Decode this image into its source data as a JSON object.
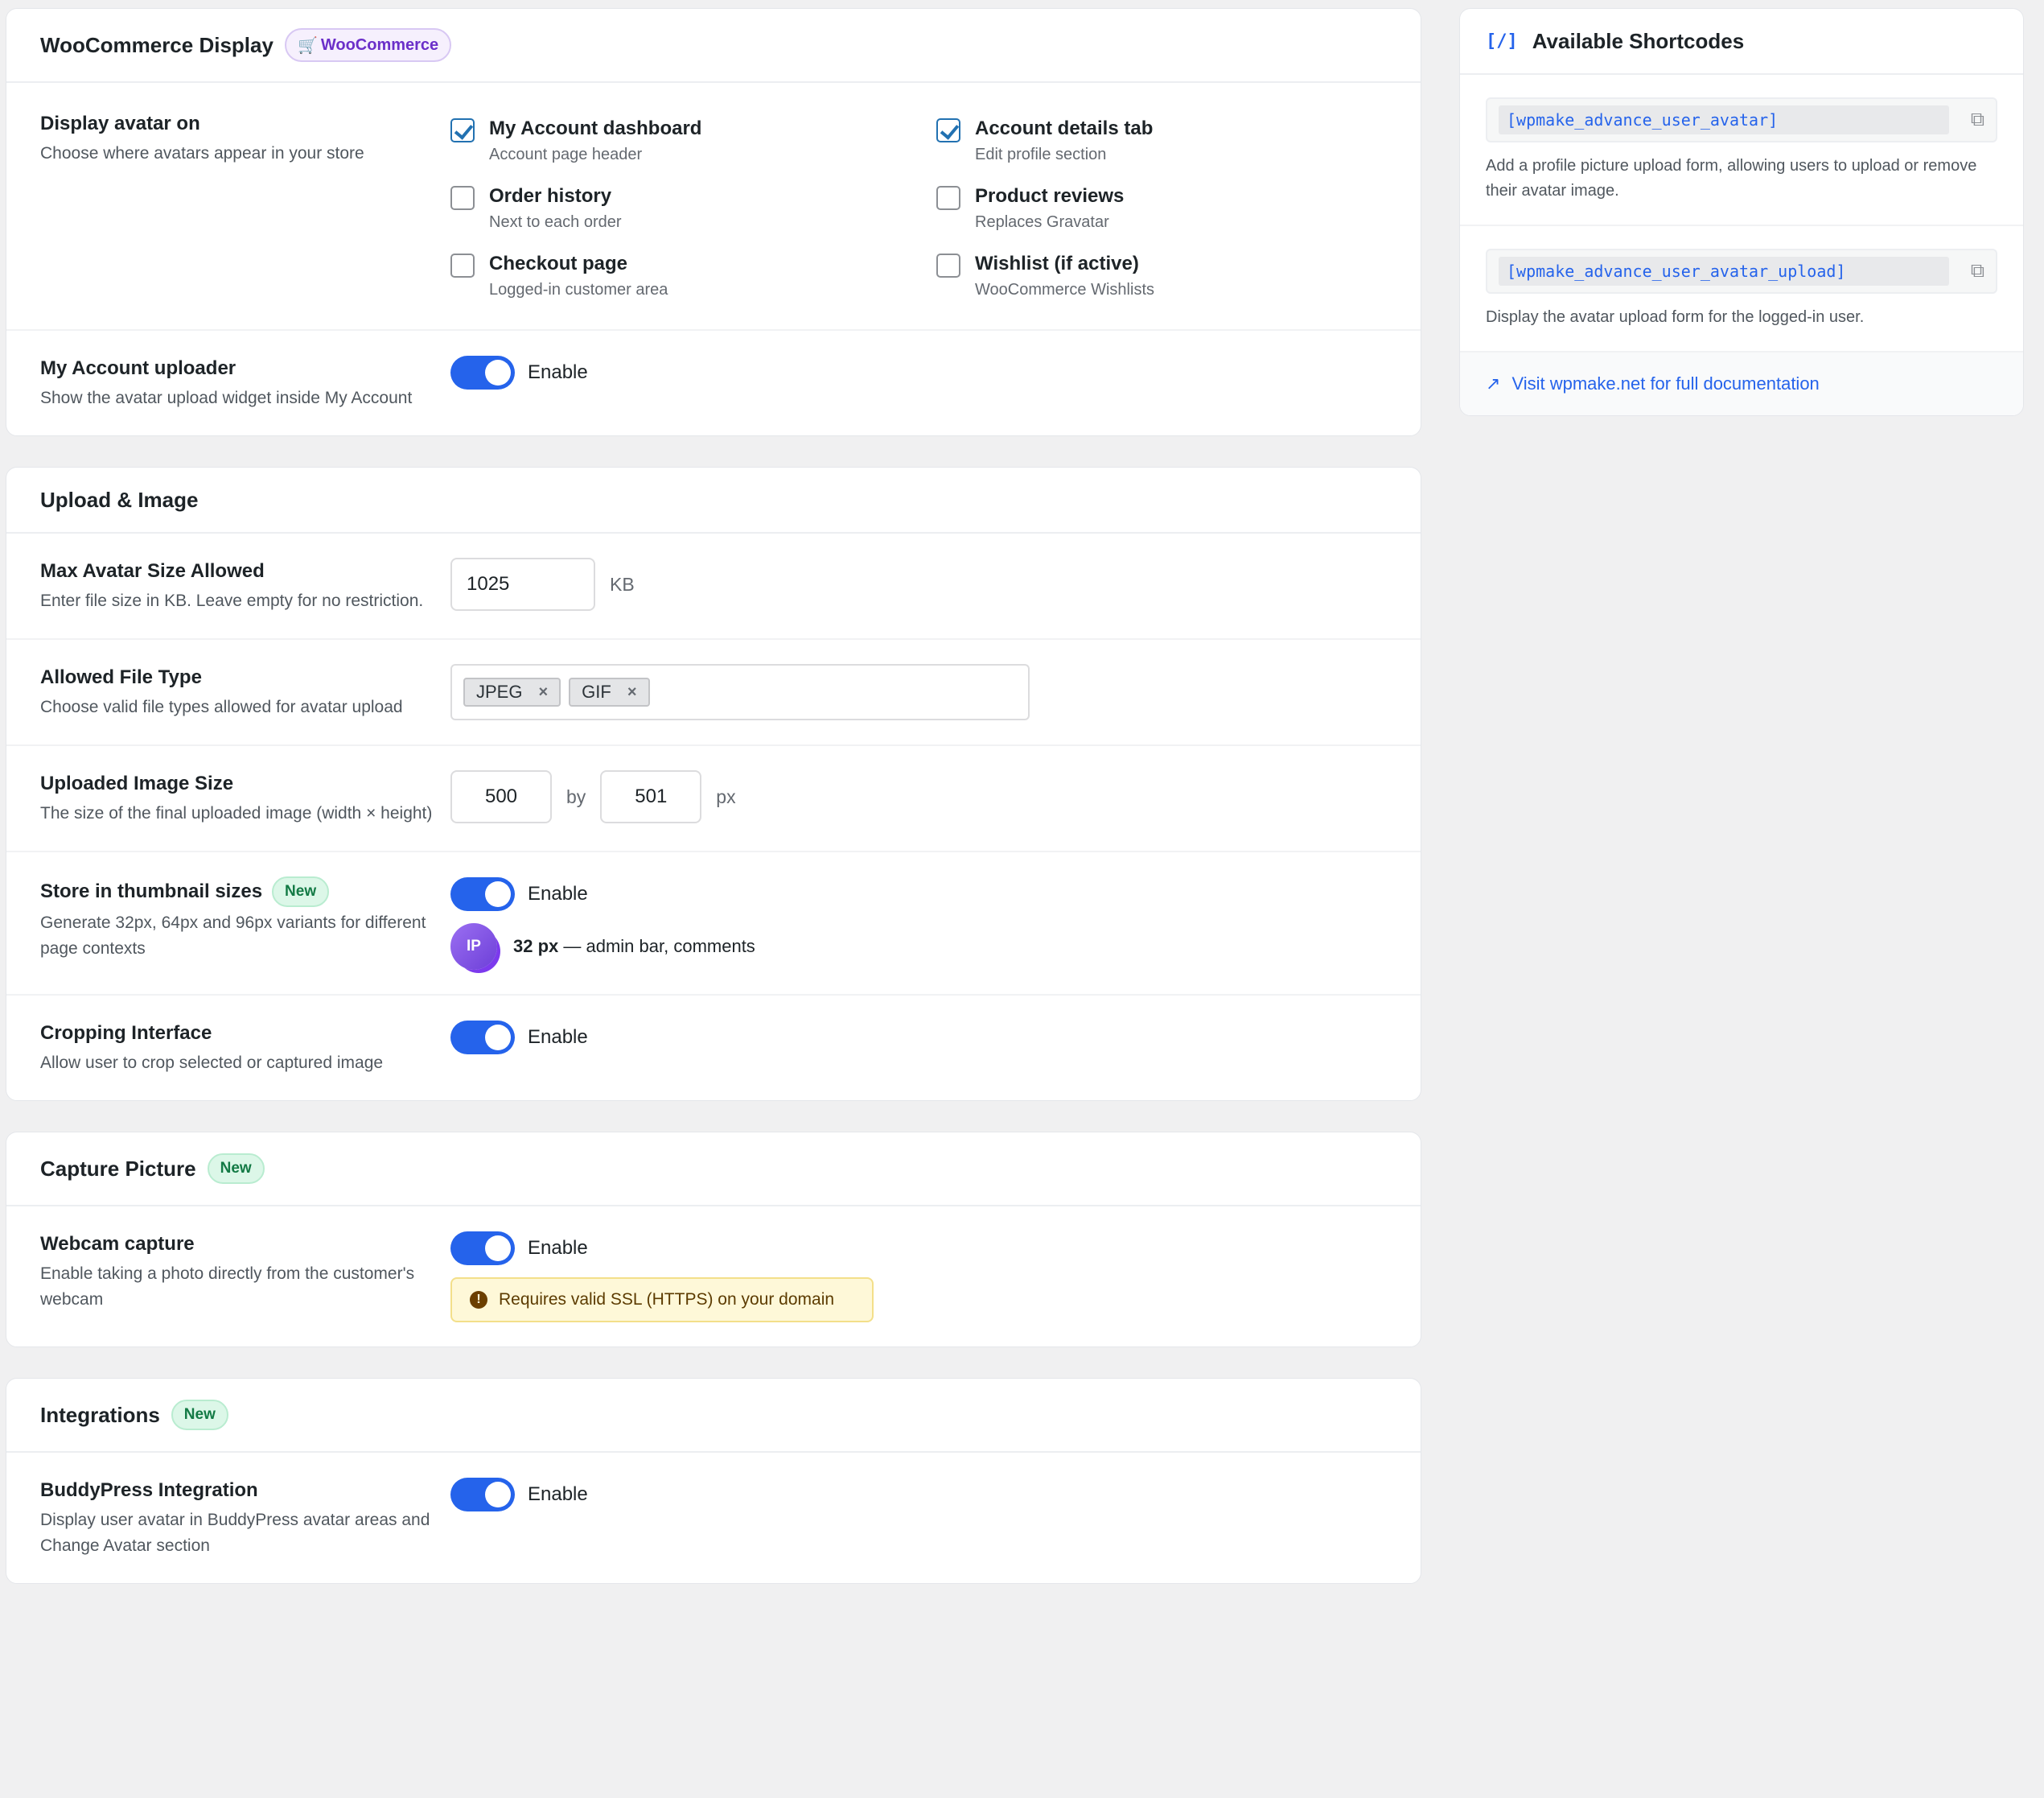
{
  "woo": {
    "title": "WooCommerce Display",
    "badge": "WooCommerce",
    "display_avatar": {
      "title": "Display avatar on",
      "desc": "Choose where avatars appear in your store",
      "options": [
        {
          "title": "My Account dashboard",
          "sub": "Account page header",
          "checked": true
        },
        {
          "title": "Account details tab",
          "sub": "Edit profile section",
          "checked": true
        },
        {
          "title": "Order history",
          "sub": "Next to each order",
          "checked": false
        },
        {
          "title": "Product reviews",
          "sub": "Replaces Gravatar",
          "checked": false
        },
        {
          "title": "Checkout page",
          "sub": "Logged-in customer area",
          "checked": false
        },
        {
          "title": "Wishlist (if active)",
          "sub": "WooCommerce Wishlists",
          "checked": false
        }
      ]
    },
    "uploader": {
      "title": "My Account uploader",
      "desc": "Show the avatar upload widget inside My Account",
      "toggle_label": "Enable"
    }
  },
  "upload": {
    "title": "Upload & Image",
    "max_size": {
      "title": "Max Avatar Size Allowed",
      "desc": "Enter file size in KB. Leave empty for no restriction.",
      "value": "1025",
      "unit": "KB"
    },
    "file_type": {
      "title": "Allowed File Type",
      "desc": "Choose valid file types allowed for avatar upload",
      "tags": [
        "JPEG",
        "GIF"
      ],
      "remove_glyph": "×"
    },
    "image_size": {
      "title": "Uploaded Image Size",
      "desc": "The size of the final uploaded image (width × height)",
      "width": "500",
      "by": "by",
      "height": "501",
      "unit": "px"
    },
    "thumbnail": {
      "title": "Store in thumbnail sizes",
      "badge": "New",
      "desc": "Generate 32px, 64px and 96px variants for different page contexts",
      "toggle_label": "Enable",
      "avatar_initials": "IP",
      "preview_size": "32 px",
      "preview_text": " — admin bar, comments"
    },
    "cropping": {
      "title": "Cropping Interface",
      "desc": "Allow user to crop selected or captured image",
      "toggle_label": "Enable"
    }
  },
  "capture": {
    "title": "Capture Picture",
    "badge": "New",
    "webcam": {
      "title": "Webcam capture",
      "desc": "Enable taking a photo directly from the customer's webcam",
      "toggle_label": "Enable",
      "warning_icon": "!",
      "warning": "Requires valid SSL (HTTPS) on your domain"
    }
  },
  "integrations": {
    "title": "Integrations",
    "badge": "New",
    "buddypress": {
      "title": "BuddyPress Integration",
      "desc": "Display user avatar in BuddyPress avatar areas and Change Avatar section",
      "toggle_label": "Enable"
    }
  },
  "shortcodes": {
    "icon": "[/]",
    "title": "Available Shortcodes",
    "items": [
      {
        "code": "[wpmake_advance_user_avatar]",
        "desc": "Add a profile picture upload form, allowing users to upload or remove their avatar image."
      },
      {
        "code": "[wpmake_advance_user_avatar_upload]",
        "desc": "Display the avatar upload form for the logged-in user."
      }
    ],
    "link": "Visit wpmake.net for full documentation"
  },
  "colors": {
    "accent": "#2563eb",
    "woo_badge": "#6b2fc9",
    "new_badge": "#137a45",
    "warning_bg": "#fef8d8"
  }
}
